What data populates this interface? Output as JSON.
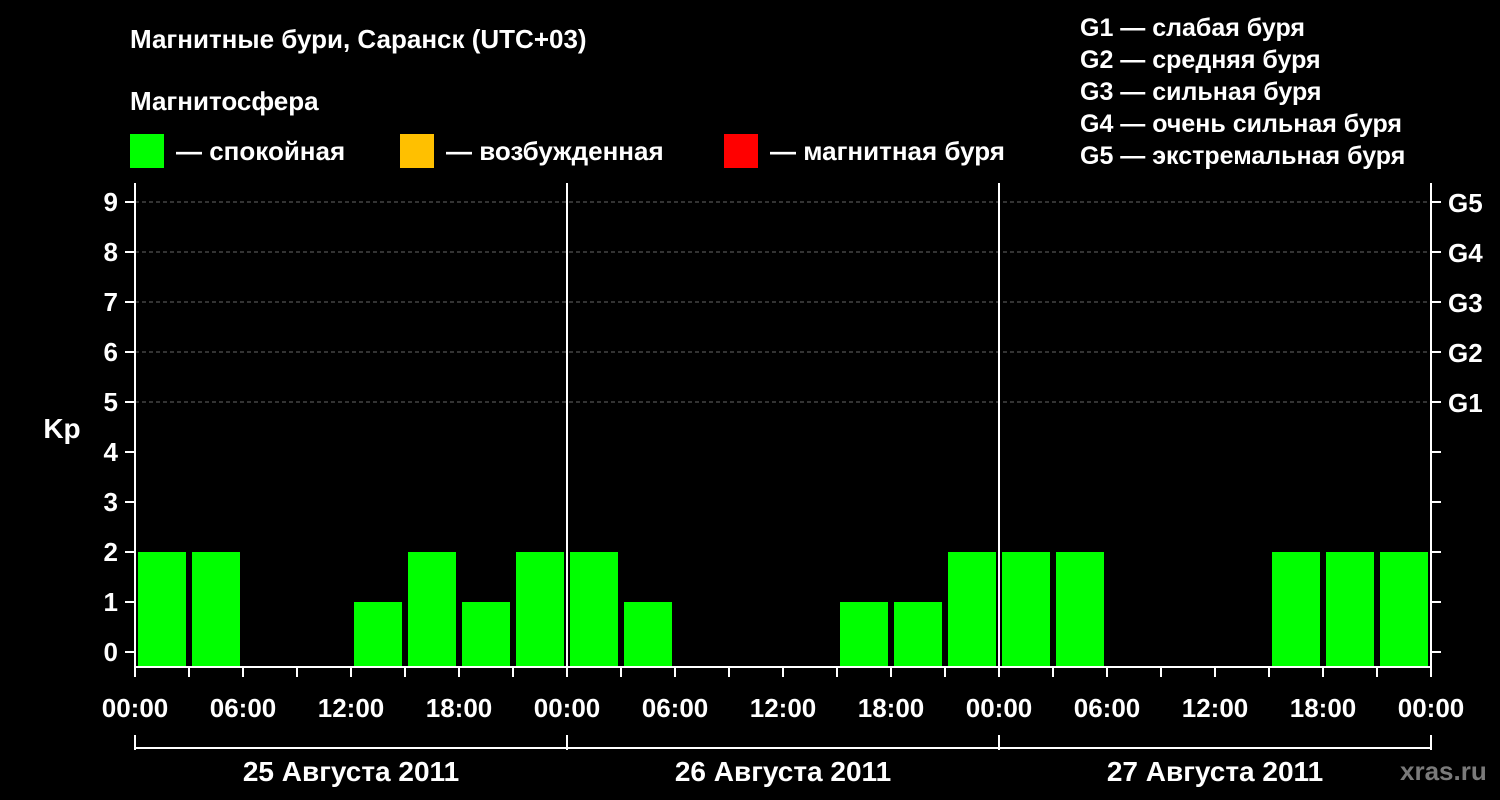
{
  "title": "Магнитные бури, Саранск (UTC+03)",
  "subtitle": "Магнитосфера",
  "state_legend": [
    {
      "label": "— спокойная",
      "color": "#00ff00"
    },
    {
      "label": "— возбужденная",
      "color": "#ffc000"
    },
    {
      "label": "— магнитная буря",
      "color": "#ff0000"
    }
  ],
  "g_legend": [
    "G1 — слабая буря",
    "G2 — средняя буря",
    "G3 — сильная буря",
    "G4 — очень сильная буря",
    "G5 — экстремальная буря"
  ],
  "watermark": "xras.ru",
  "chart_data": {
    "type": "bar",
    "ylabel": "Kp",
    "ylim": [
      0,
      9
    ],
    "y_ticks": [
      "0",
      "1",
      "2",
      "3",
      "4",
      "5",
      "6",
      "7",
      "8",
      "9"
    ],
    "right_ticks": [
      {
        "kp": 5,
        "label": "G1"
      },
      {
        "kp": 6,
        "label": "G2"
      },
      {
        "kp": 7,
        "label": "G3"
      },
      {
        "kp": 8,
        "label": "G4"
      },
      {
        "kp": 9,
        "label": "G5"
      }
    ],
    "x_tick_labels": [
      "00:00",
      "06:00",
      "12:00",
      "18:00",
      "00:00",
      "06:00",
      "12:00",
      "18:00",
      "00:00",
      "06:00",
      "12:00",
      "18:00",
      "00:00"
    ],
    "days": [
      "25 Августа 2011",
      "26 Августа 2011",
      "27 Августа 2011"
    ],
    "interval_hours": 3,
    "values": [
      2,
      2,
      0,
      0,
      1,
      2,
      1,
      2,
      2,
      1,
      0,
      0,
      0,
      1,
      1,
      2,
      2,
      2,
      0,
      0,
      0,
      2,
      2,
      2
    ],
    "bar_color": "#00ff00",
    "grid": true
  }
}
